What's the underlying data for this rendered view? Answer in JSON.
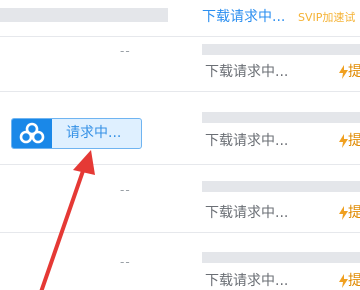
{
  "rows": [
    {
      "status": "下载请求中...",
      "svip": "SVIP加速试",
      "dash": "--"
    },
    {
      "status": "下载请求中...",
      "speed_char": "提",
      "dash": "--"
    },
    {
      "status": "下载请求中...",
      "speed_char": "提",
      "dash": "--"
    },
    {
      "status": "下载请求中...",
      "speed_char": "提",
      "dash": "--"
    },
    {
      "status": "下载请求中...",
      "speed_char": "提",
      "dash": "--"
    }
  ],
  "request_button": {
    "label": "请求中...",
    "icon": "baidu-cloud-icon",
    "color": "#1a88e8"
  },
  "annotation": {
    "arrow_color": "#e53935"
  },
  "colors": {
    "accent": "#2c8ff0",
    "svip": "#f5b233",
    "bolt": "#f0a020"
  }
}
